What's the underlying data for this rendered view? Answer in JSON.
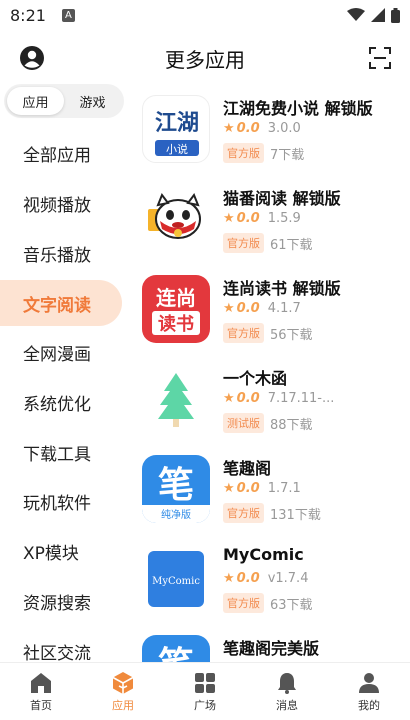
{
  "status": {
    "time": "8:21",
    "notif": "A"
  },
  "header": {
    "title": "更多应用"
  },
  "segments": [
    "应用",
    "游戏"
  ],
  "categories": [
    {
      "label": "全部应用"
    },
    {
      "label": "视频播放"
    },
    {
      "label": "音乐播放"
    },
    {
      "label": "文字阅读",
      "active": true
    },
    {
      "label": "全网漫画"
    },
    {
      "label": "系统优化"
    },
    {
      "label": "下载工具"
    },
    {
      "label": "玩机软件"
    },
    {
      "label": "XP模块"
    },
    {
      "label": "资源搜索"
    },
    {
      "label": "社区交流"
    }
  ],
  "apps": [
    {
      "name": "江湖免费小说 解锁版",
      "rating": "0.0",
      "version": "3.0.0",
      "tag": "官方版",
      "downloads": "7下载",
      "icon": "jianghu-novel-icon",
      "icon_text_top": "江湖",
      "icon_text_bottom": "小说"
    },
    {
      "name": "猫番阅读 解锁版",
      "rating": "0.0",
      "version": "1.5.9",
      "tag": "官方版",
      "downloads": "61下载",
      "icon": "maofan-cat-icon"
    },
    {
      "name": "连尚读书 解锁版",
      "rating": "0.0",
      "version": "4.1.7",
      "tag": "官方版",
      "downloads": "56下载",
      "icon": "lianshang-icon",
      "icon_text_top": "连尚",
      "icon_text_bottom": "读书"
    },
    {
      "name": "一个木函",
      "rating": "0.0",
      "version": "7.17.11-...",
      "tag": "测试版",
      "downloads": "88下载",
      "icon": "tree-icon"
    },
    {
      "name": "笔趣阁",
      "rating": "0.0",
      "version": "1.7.1",
      "tag": "官方版",
      "downloads": "131下载",
      "icon": "biquge-icon",
      "icon_text_top": "笔",
      "icon_text_bottom": "纯净版"
    },
    {
      "name": "MyComic",
      "rating": "0.0",
      "version": "v1.7.4",
      "tag": "官方版",
      "downloads": "63下载",
      "icon": "mycomic-icon",
      "icon_text_top": "MyComic"
    },
    {
      "name": "笔趣阁完美版",
      "rating": "",
      "version": "",
      "tag": "",
      "downloads": "",
      "icon": "biquge-perfect-icon",
      "icon_text_top": "笔"
    }
  ],
  "nav": [
    {
      "label": "首页",
      "icon": "home-icon"
    },
    {
      "label": "应用",
      "icon": "apps-cube-icon",
      "active": true
    },
    {
      "label": "广场",
      "icon": "grid-icon"
    },
    {
      "label": "消息",
      "icon": "bell-icon"
    },
    {
      "label": "我的",
      "icon": "person-icon"
    }
  ],
  "colors": {
    "accent": "#f08a3c",
    "active_bg": "#fde3d2",
    "tag_bg": "#fde9dc",
    "star": "#f5a04f"
  }
}
